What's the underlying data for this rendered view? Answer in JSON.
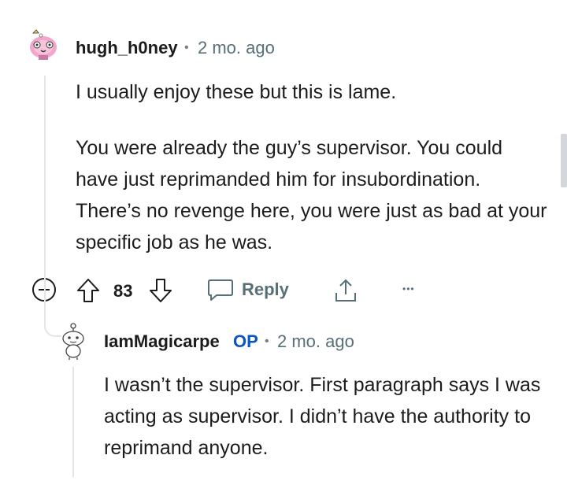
{
  "comment": {
    "username": "hugh_h0ney",
    "separator": "•",
    "age": "2 mo. ago",
    "paragraphs": [
      "I usually enjoy these but this is lame.",
      "You were already the guy’s supervisor. You could have just reprimanded him for insubordination. There’s no revenge here, you were just as bad at your specific job as he was."
    ],
    "votes": "83",
    "reply_label": "Reply",
    "more_label": "•••"
  },
  "reply": {
    "username": "IamMagicarpe",
    "op_badge": "OP",
    "separator": "•",
    "age": "2 mo. ago",
    "text": "I wasn’t the supervisor. First paragraph says I was acting as supervisor. I didn’t have the authority to reprimand anyone."
  },
  "colors": {
    "text": "#1c1c1c",
    "muted": "#576f76",
    "op": "#0a55c4",
    "thread": "#e3e5e7"
  }
}
